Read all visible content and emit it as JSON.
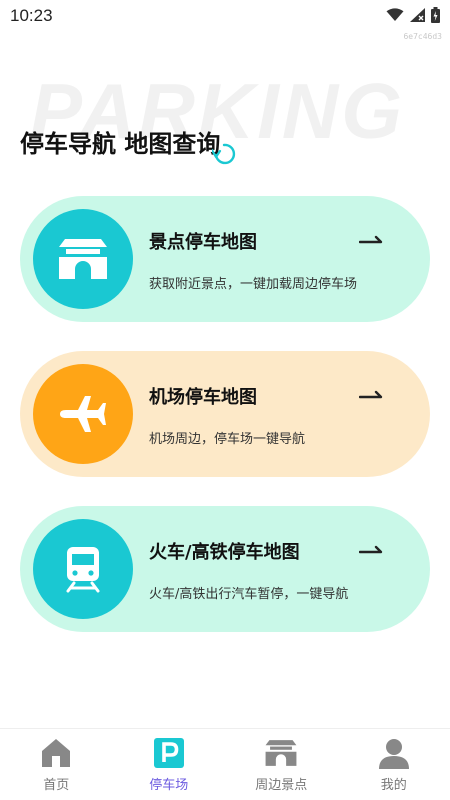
{
  "status": {
    "time": "10:23",
    "small_id": "6e7c46d3"
  },
  "watermark": "PARKING",
  "headline": "停车导航 地图查询",
  "colors": {
    "card_green": "#c9f8e8",
    "card_orange": "#fde9c8",
    "circle_teal": "#1ac8d2",
    "circle_orange": "#ffa516",
    "tab_active": "#6d5ce0"
  },
  "cards": [
    {
      "title": "景点停车地图",
      "subtitle": "获取附近景点，一键加载周边停车场",
      "icon": "gate-icon"
    },
    {
      "title": "机场停车地图",
      "subtitle": "机场周边，停车场一键导航",
      "icon": "airplane-icon"
    },
    {
      "title": "火车/高铁停车地图",
      "subtitle": "火车/高铁出行汽车暂停，一键导航",
      "icon": "train-icon"
    }
  ],
  "tabs": [
    {
      "label": "首页",
      "icon": "home-icon",
      "active": false
    },
    {
      "label": "停车场",
      "icon": "parking-icon",
      "active": true
    },
    {
      "label": "周边景点",
      "icon": "gate-icon",
      "active": false
    },
    {
      "label": "我的",
      "icon": "person-icon",
      "active": false
    }
  ]
}
